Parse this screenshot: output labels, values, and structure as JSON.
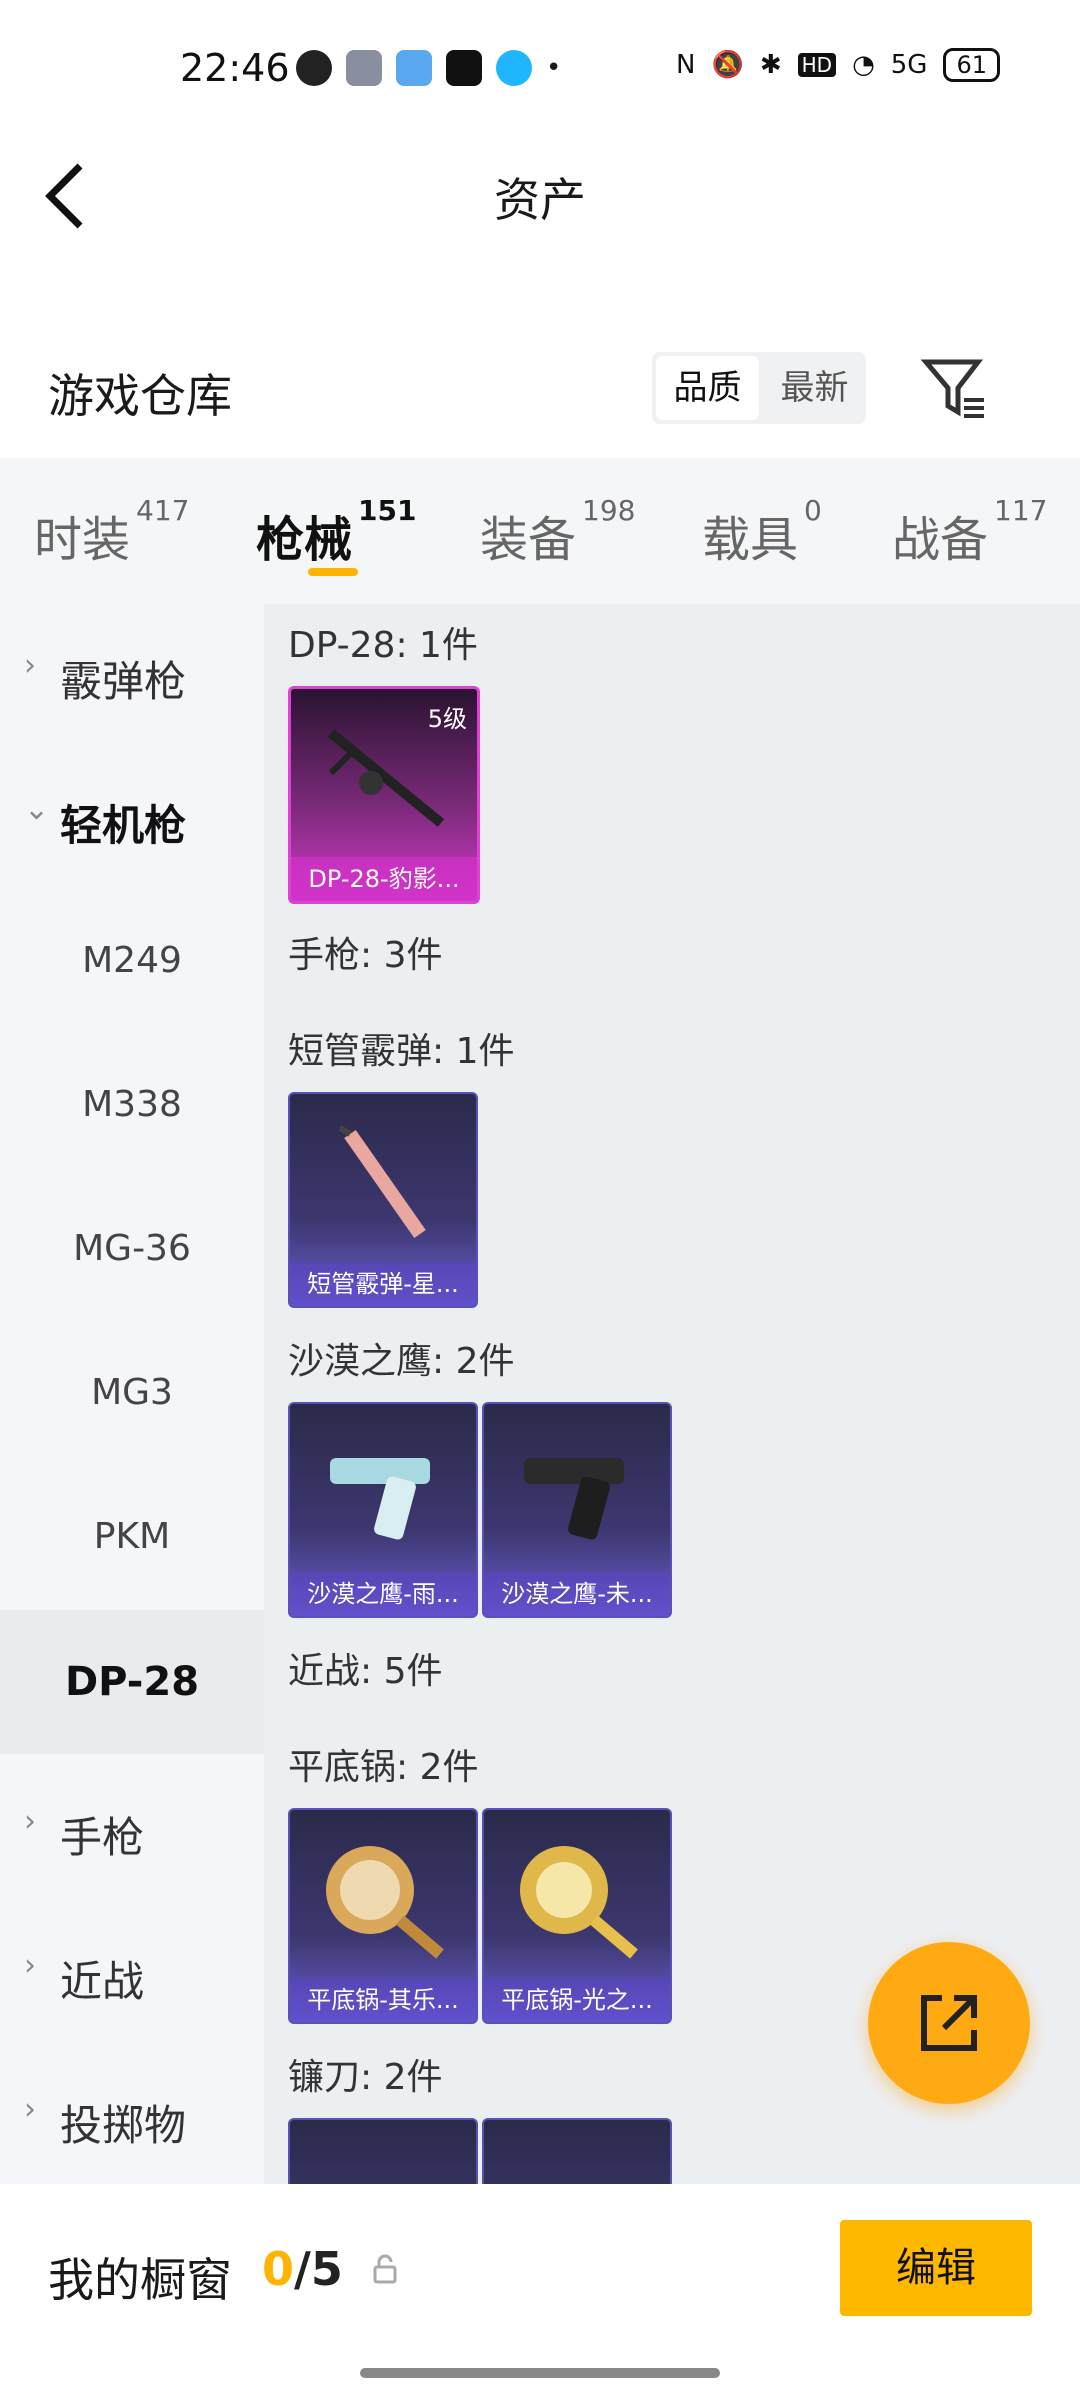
{
  "status_bar": {
    "time": "22:46",
    "signal": "5G",
    "battery": "61",
    "hd": "HD"
  },
  "nav": {
    "title": "资产",
    "back_icon": "chevron-left-icon"
  },
  "repository": {
    "title": "游戏仓库",
    "sort_quality": "品质",
    "sort_newest": "最新",
    "filter_icon": "filter-icon"
  },
  "tabs": [
    {
      "label": "时装",
      "count": "417"
    },
    {
      "label": "枪械",
      "count": "151"
    },
    {
      "label": "装备",
      "count": "198"
    },
    {
      "label": "载具",
      "count": "0"
    },
    {
      "label": "战备",
      "count": "117"
    }
  ],
  "sidebar": {
    "shotgun": "霰弹枪",
    "lmg": "轻机枪",
    "sub": [
      "M249",
      "M338",
      "MG-36",
      "MG3",
      "PKM",
      "DP-28"
    ],
    "pistol": "手枪",
    "melee": "近战",
    "throwable": "投掷物"
  },
  "content": {
    "sections": [
      {
        "header": "DP-28: 1件"
      },
      {
        "header": "手枪: 3件"
      },
      {
        "header": "短管霰弹: 1件"
      },
      {
        "header": "沙漠之鹰: 2件"
      },
      {
        "header": "近战: 5件"
      },
      {
        "header": "平底锅: 2件"
      },
      {
        "header": "镰刀: 2件"
      }
    ],
    "cards": [
      {
        "name": "DP-28-豹影...",
        "level": "5级"
      },
      {
        "name": "短管霰弹-星..."
      },
      {
        "name": "沙漠之鹰-雨..."
      },
      {
        "name": "沙漠之鹰-未..."
      },
      {
        "name": "平底锅-其乐..."
      },
      {
        "name": "平底锅-光之..."
      }
    ]
  },
  "bottom": {
    "title": "我的橱窗",
    "count_current": "0",
    "count_total": "/5",
    "edit_label": "编辑"
  },
  "colors": {
    "accent": "#ffb400",
    "fab": "#ffaa12",
    "legendary": "#e23fd6",
    "epic": "#5b50b8"
  }
}
